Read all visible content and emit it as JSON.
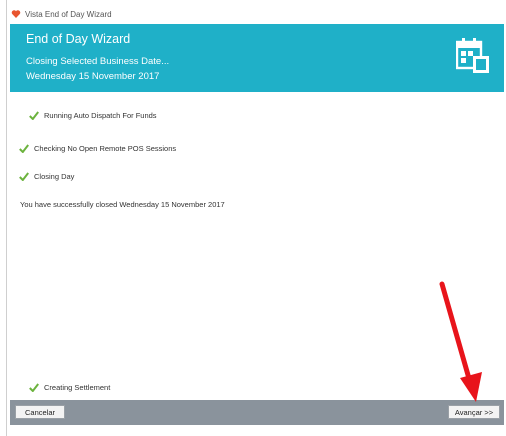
{
  "window": {
    "title": "Vista End of Day Wizard"
  },
  "header": {
    "title": "End of Day Wizard",
    "subtitle": "Closing Selected Business Date...",
    "date": "Wednesday 15 November 2017",
    "icon": "calendar-icon",
    "background_color": "#1fb0c8"
  },
  "steps": [
    {
      "label": "Running Auto Dispatch For Funds",
      "status": "check-icon"
    },
    {
      "label": "Checking No Open Remote POS Sessions",
      "status": "check-icon"
    },
    {
      "label": "Closing Day",
      "status": "check-icon"
    },
    {
      "label": "Creating Settlement",
      "status": "check-icon"
    }
  ],
  "success_message": "You have successfully closed Wednesday 15 November 2017",
  "footer": {
    "cancel_label": "Cancelar",
    "next_label": "Avançar >>"
  },
  "annotation": {
    "icon": "red-arrow-icon",
    "color": "#e8141b"
  }
}
